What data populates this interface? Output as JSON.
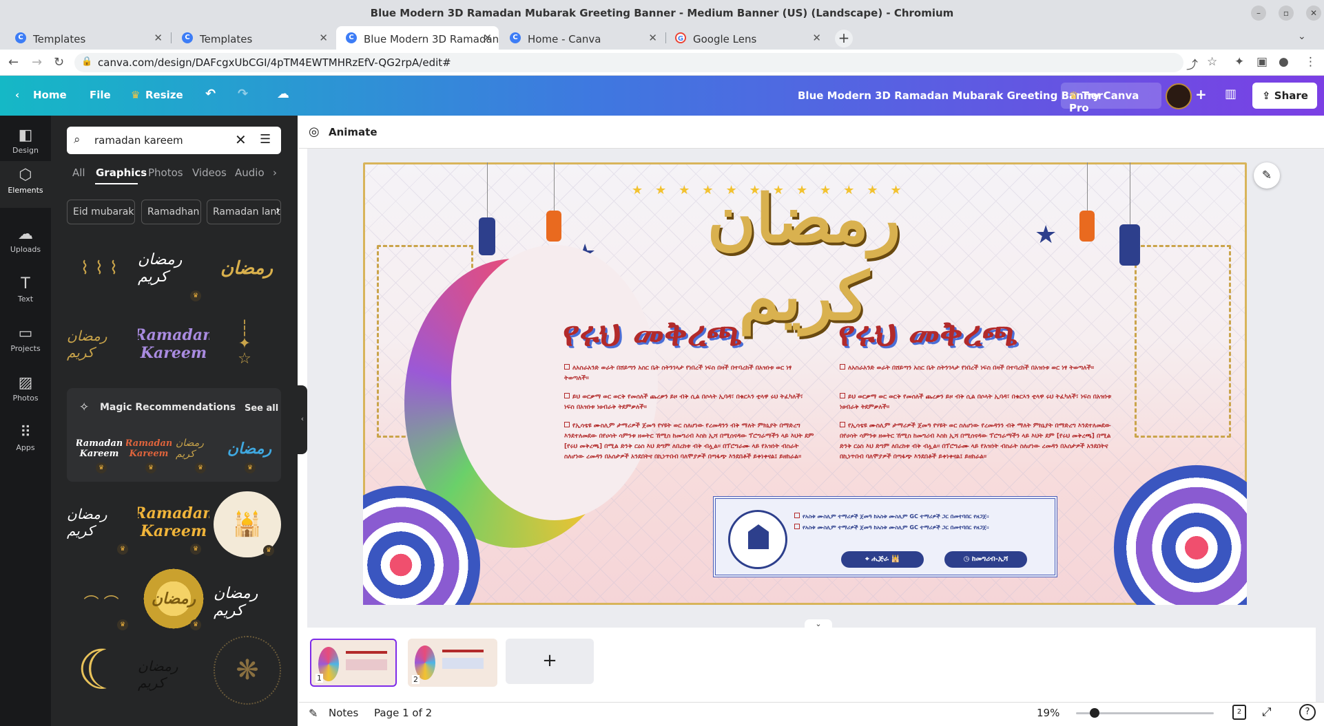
{
  "window": {
    "title": "Blue Modern 3D Ramadan Mubarak Greeting Banner - Medium Banner (US) (Landscape) - Chromium"
  },
  "tabs": [
    {
      "label": "Templates"
    },
    {
      "label": "Templates"
    },
    {
      "label": "Blue Modern 3D Ramadan"
    },
    {
      "label": "Home - Canva"
    },
    {
      "label": "Google Lens"
    }
  ],
  "address": {
    "url": "canva.com/design/DAFcgxUbCGI/4pTM4EWTMHRzEfV-QG2rpA/edit#"
  },
  "topbar": {
    "home": "Home",
    "file": "File",
    "resize": "Resize",
    "doc_title": "Blue Modern 3D Ramadan Mubarak Greeting Banner",
    "try_pro": "Try Canva Pro",
    "share": "Share"
  },
  "rail": [
    {
      "label": "Design",
      "icon": "design-icon"
    },
    {
      "label": "Elements",
      "icon": "elements-icon"
    },
    {
      "label": "Uploads",
      "icon": "uploads-icon"
    },
    {
      "label": "Text",
      "icon": "text-icon"
    },
    {
      "label": "Projects",
      "icon": "projects-icon"
    },
    {
      "label": "Photos",
      "icon": "photos-icon"
    },
    {
      "label": "Apps",
      "icon": "apps-icon"
    }
  ],
  "panel": {
    "search_value": "ramadan kareem",
    "tabs": [
      "All",
      "Graphics",
      "Photos",
      "Videos",
      "Audio"
    ],
    "chips": [
      "Eid mubarak",
      "Ramadhan",
      "Ramadan lant"
    ],
    "magic_title": "Magic Recommendations",
    "see_all": "See all",
    "graphic_texts": {
      "g1": "Ramadan Kareem",
      "m1": "Ramadan Kareem",
      "m2": "Ramadan Kareem",
      "g9": "Ramadan Kareem",
      "g10": "Ramadan Kareem"
    }
  },
  "canvas_toolbar": {
    "animate": "Animate"
  },
  "banner": {
    "heading_left": "የሩህ መቅረጫ",
    "heading_right": "የሩህ መቅረጫ",
    "left_bullets": [
      "ለአስራአንድ ወራት በሸይጣን አስር ቤት ስትንገላታ የነበረች ነፍስ በዛች በተባረከች በአዝነቱ ወር ነፃ ትወጣለች።",
      "ይህ ወርቃማ ወር ወርቅ የመሰለች ጨረቃን ይዞ ብቅ ሲል በሶላት ኢባዳ፣ በቁርኣን ቲላዋ ሩህ ትፈካለች፣ ነፍስ በአዝነቱ ነፀብራቅ ትደምቃለች።",
      "የኢሳቴዩ ሙስሊም ታማሪዎች ጀመዓ የሃዩት ወር ስለሆነው የረመዳንን ብቅ ማለት ምክኒያት በማድረግ እንደተለመደው በየሀሳት ሳምንቱ ዘወትር ኸሚስ ከመግሪብ እስከ ኢሻ በሚሰናዳው ፕሮግራማችን ላይ እህት ደም [የሩህ መቅረጫ] በሚል ድንቅ ርዕስ እህ ድግም ለበረከቱ ብቅ ብሏል። በፕሮግራሙ ላይ የአዝነት ብስራት ስለሆነው ረመዳን በአሰታዎች አንደበትና በኪነጥበብ ባለሞያዎች በጣፋጭ እንደበቶች ይቀነቀናል፤ ይዘከራል።"
    ],
    "right_bullets": [
      "ለአስራአንድ ወራት በሸይጣን አስር ቤት ስትንገላታ የነበረች ነፍስ በዛች በተባረከች በአዝነቱ ወር ነፃ ትወጣለች።",
      "ይህ ወርቃማ ወር ወርቅ የመሰለች ጨረቃን ይዞ ብቅ ሲል በሶላት ኢባዳ፣ በቁርኣን ቲላዋ ሩህ ትፈካለች፣ ነፍስ በአዝነቱ ነፀብራቅ ትደምቃለች።",
      "የኢሳቴዩ ሙስሊም ታማሪዎች ጀመዓ የሃዩት ወር ስለሆነው የረመዳንን ብቅ ማለት ምክኒያት በማድረግ እንደተለመደው በየሀሳት ሳምንቱ ዘወትር ኸሚስ ከመግሪብ እስከ ኢሻ በሚሰናዳው ፕሮግራማችን ላይ እህት ደም [የሩህ መቅረጫ] በሚል ድንቅ ርዕስ እህ ድግም ለበረከቱ ብቅ ብሏል። በፕሮግራሙ ላይ የአዝነት ብስራት ስለሆነው ረመዳን በአሰታዎች አንደበትና በኪነጥበብ ባለሞያዎች በጣፋጭ እንደበቶች ይቀነቀናል፤ ይዘከራል።"
    ],
    "info_lines": [
      "የአስቱ ሙስሊም ተማሪዎች ጀመዓ ከአስቱ ሙስሊም GC ተማሪዎች ጋር በመተባበር የዘጋጀ።",
      "የአስቱ ሙስሊም ተማሪዎች ጀመዓ ከአስቱ ሙስሊም GC ተማሪዎች ጋር በመተባበር የዘጋጀ።"
    ],
    "pill_left": "ሒጅራ 🕌",
    "pill_right": "ከመግሪብ-ኢሻ"
  },
  "pages": {
    "thumb1": "1",
    "thumb2": "2",
    "add": "+"
  },
  "bottom": {
    "notes": "Notes",
    "page_info": "Page 1 of 2",
    "zoom": "19%",
    "zoom_value": 0.19,
    "page_count_badge": "2"
  }
}
